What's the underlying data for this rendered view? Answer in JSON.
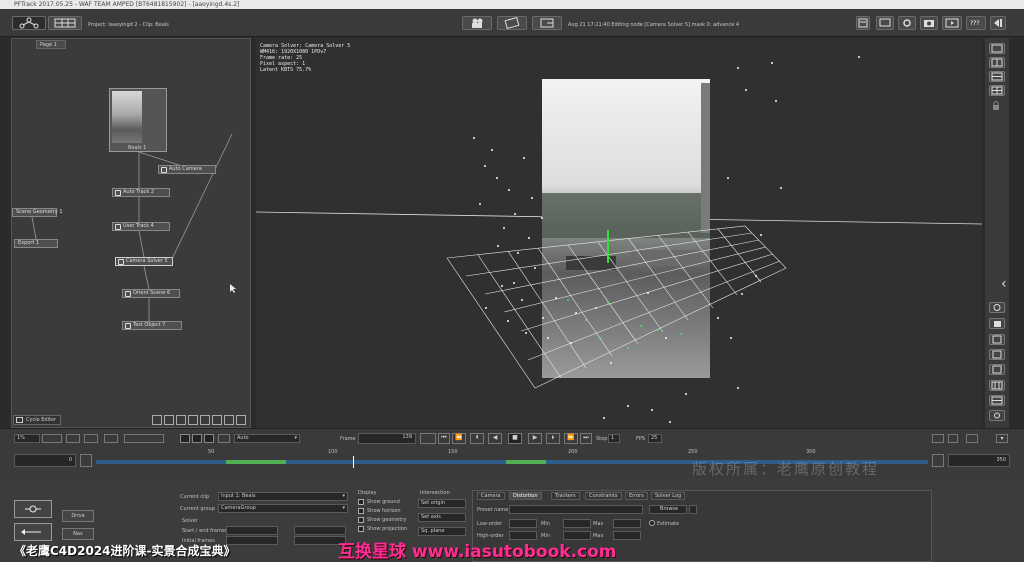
{
  "titlebar": {
    "text": "PFTrack 2017.05.25 - WAF TEAM AMPED [BT6481815902] - [aaoyingd.4s.2]"
  },
  "toolbar": {
    "project_label": "Project: laaoyingd 2 - Clip: Beals",
    "status_text": "Aug 21 17:21:40 Editing node [Camera Solver 5] mask 0: advance 4",
    "help_label": "???"
  },
  "node_editor": {
    "tab_label": "Page 1",
    "footer_label": "Cycle Editor",
    "nodes": [
      {
        "label": "Beals 1"
      },
      {
        "label": "Auto Camera"
      },
      {
        "label": "Auto Track 2"
      },
      {
        "label": "User Track 4"
      },
      {
        "label": "Camera Solver 5"
      },
      {
        "label": "Orient Scene 6"
      },
      {
        "label": "Test Object 7"
      },
      {
        "label": "Scene Geometry 1"
      },
      {
        "label": "Export 1"
      }
    ]
  },
  "viewport": {
    "info_lines": [
      "Camera Solver: Camera Solver 5",
      "WM416: 1920X1080 1PDv7",
      "Frame rate: 25",
      "Pixel aspect: 1",
      "Latent KBTS 75.7%"
    ]
  },
  "playback": {
    "zoom_value": "1%",
    "mode_value": "Auto",
    "frame_label": "Frame",
    "frame_value": "139",
    "step_label": "Step",
    "step_value": "1",
    "fps_label": "FPS",
    "fps_value": "25"
  },
  "timeline": {
    "start_frame": "0",
    "end_frame": "350",
    "ticks": [
      "50",
      "100",
      "150",
      "200",
      "250",
      "300"
    ]
  },
  "bottom_panel": {
    "left_buttons": [
      "Drive",
      "Nav"
    ],
    "current_clip_label": "Current clip",
    "current_clip_value": "Input 1: Beals",
    "current_group_label": "Current group",
    "current_group_value": "CameraGroup",
    "solver_label": "Solver",
    "start_end_label": "Start / end frames",
    "initial_frames_label": "Initial frames",
    "display_label": "Display",
    "display_options": [
      "Show ground",
      "Show horizon",
      "Show geometry",
      "Show projection"
    ],
    "intersection_label": "Intersection",
    "intersection_buttons": [
      "Set origin",
      "Set axis",
      "Sq. plane"
    ],
    "tabs": [
      "Camera",
      "Distortion",
      "Trackers",
      "Constraints",
      "Errors",
      "Solver Log"
    ],
    "preset_label": "Preset name",
    "browse_label": "Browse",
    "low_order_label": "Low-order",
    "high_order_label": "High-order",
    "min_label": "Min",
    "max_label": "Max",
    "estimate_label": "Estimate"
  },
  "overlays": {
    "course_title": "《老鹰C4D2024进阶课-实景合成宝典》",
    "site_text": "互换星球 www.iasutobook.com",
    "watermark": "版权所属：老鹰原创教程"
  }
}
